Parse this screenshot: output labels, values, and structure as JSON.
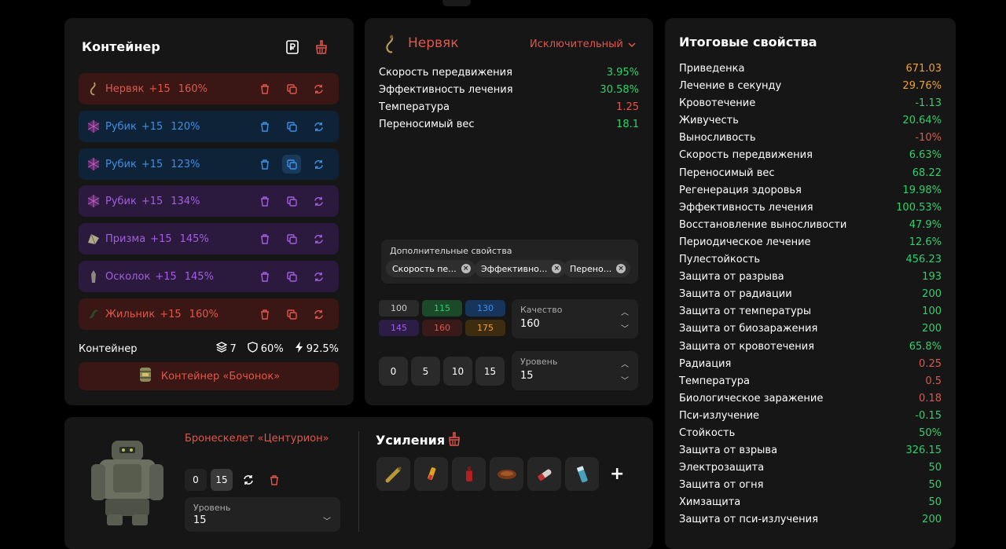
{
  "container": {
    "title": "Контейнер",
    "artifacts": [
      {
        "name": "Нервяк",
        "level": "+15",
        "pct": "160%",
        "rarity": "red"
      },
      {
        "name": "Рубик",
        "level": "+15",
        "pct": "120%",
        "rarity": "blue"
      },
      {
        "name": "Рубик",
        "level": "+15",
        "pct": "123%",
        "rarity": "blue"
      },
      {
        "name": "Рубик",
        "level": "+15",
        "pct": "134%",
        "rarity": "purple"
      },
      {
        "name": "Призма",
        "level": "+15",
        "pct": "145%",
        "rarity": "purple"
      },
      {
        "name": "Осколок",
        "level": "+15",
        "pct": "145%",
        "rarity": "purple"
      },
      {
        "name": "Жильник",
        "level": "+15",
        "pct": "160%",
        "rarity": "red"
      }
    ],
    "summary": {
      "label": "Контейнер",
      "slots": "7",
      "protection": "60%",
      "efficiency": "92.5%"
    },
    "container_name": "Контейнер «Бочонок»"
  },
  "detail": {
    "name": "Нервяк",
    "rarity": "Исключительный",
    "properties": [
      {
        "name": "Скорость передвижения",
        "value": "3.95%",
        "color": "green"
      },
      {
        "name": "Эффективность лечения",
        "value": "30.58%",
        "color": "green"
      },
      {
        "name": "Температура",
        "value": "1.25",
        "color": "red"
      },
      {
        "name": "Переносимый вес",
        "value": "18.1",
        "color": "green"
      }
    ],
    "extra": {
      "title": "Дополнительные свойства",
      "chips": [
        "Скорость пе...",
        "Эффективно...",
        "Перено..."
      ]
    },
    "quality_buttons": [
      "100",
      "115",
      "130",
      "145",
      "160",
      "175"
    ],
    "quality": {
      "label": "Качество",
      "value": "160"
    },
    "level_buttons": [
      "0",
      "5",
      "10",
      "15"
    ],
    "level": {
      "label": "Уровень",
      "value": "15"
    }
  },
  "totals": {
    "title": "Итоговые свойства",
    "rows": [
      {
        "name": "Приведенка",
        "value": "671.03",
        "color": "orange"
      },
      {
        "name": "Лечение в секунду",
        "value": "29.76%",
        "color": "orange"
      },
      {
        "name": "Кровотечение",
        "value": "-1.13",
        "color": "green"
      },
      {
        "name": "Живучесть",
        "value": "20.64%",
        "color": "green"
      },
      {
        "name": "Выносливость",
        "value": "-10%",
        "color": "red"
      },
      {
        "name": "Скорость передвижения",
        "value": "6.63%",
        "color": "green"
      },
      {
        "name": "Переносимый вес",
        "value": "68.22",
        "color": "green"
      },
      {
        "name": "Регенерация здоровья",
        "value": "19.98%",
        "color": "green"
      },
      {
        "name": "Эффективность лечения",
        "value": "100.53%",
        "color": "green"
      },
      {
        "name": "Восстановление выносливости",
        "value": "47.9%",
        "color": "green"
      },
      {
        "name": "Периодическое лечение",
        "value": "12.6%",
        "color": "green"
      },
      {
        "name": "Пулестойкость",
        "value": "456.23",
        "color": "green"
      },
      {
        "name": "Защита от разрыва",
        "value": "193",
        "color": "green"
      },
      {
        "name": "Защита от радиации",
        "value": "200",
        "color": "green"
      },
      {
        "name": "Защита от температуры",
        "value": "100",
        "color": "green"
      },
      {
        "name": "Защита от биозаражения",
        "value": "200",
        "color": "green"
      },
      {
        "name": "Защита от кровотечения",
        "value": "65.8%",
        "color": "green"
      },
      {
        "name": "Радиация",
        "value": "0.25",
        "color": "red"
      },
      {
        "name": "Температура",
        "value": "0.5",
        "color": "red"
      },
      {
        "name": "Биологическое заражение",
        "value": "0.18",
        "color": "red"
      },
      {
        "name": "Пси-излучение",
        "value": "-0.15",
        "color": "green"
      },
      {
        "name": "Стойкость",
        "value": "50%",
        "color": "green"
      },
      {
        "name": "Защита от взрыва",
        "value": "326.15",
        "color": "green"
      },
      {
        "name": "Электрозащита",
        "value": "50",
        "color": "green"
      },
      {
        "name": "Защита от огня",
        "value": "50",
        "color": "green"
      },
      {
        "name": "Химзащита",
        "value": "50",
        "color": "green"
      },
      {
        "name": "Защита от пси-излучения",
        "value": "200",
        "color": "green"
      }
    ]
  },
  "armor": {
    "name": "Бронескелет «Центурион»",
    "level_buttons": [
      "0",
      "15"
    ],
    "level": {
      "label": "Уровень",
      "value": "15"
    },
    "boosts_title": "Усиления",
    "boost_icons": [
      "ammo-icon",
      "syringe-icon",
      "bottle-icon",
      "food-icon",
      "stimulant-icon",
      "battery-icon"
    ],
    "add_label": "+"
  },
  "colors": {
    "green": "#31d16a",
    "red": "#e0574a",
    "orange": "#f0a12f",
    "blue": "#3d8fe8",
    "purple": "#a45de2"
  }
}
